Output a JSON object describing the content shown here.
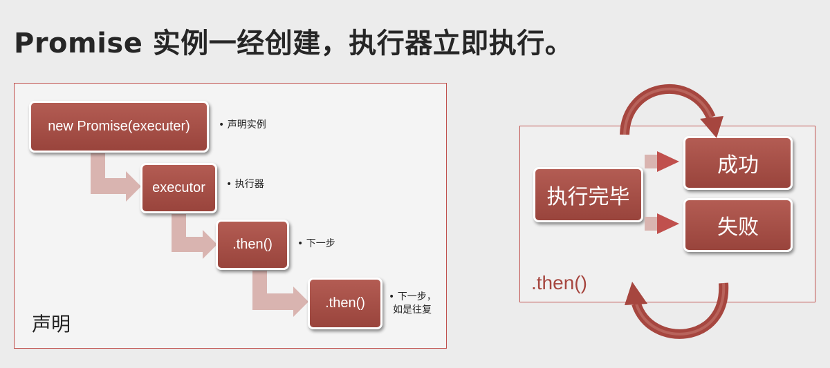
{
  "title": "Promise 实例一经创建，执行器立即执行。",
  "left_panel": {
    "label": "声明",
    "steps": [
      {
        "text": "new Promise(executer)",
        "note": "• 声明实例"
      },
      {
        "text": "executor",
        "note": "• 执行器"
      },
      {
        "text": ".then()",
        "note": "• 下一步"
      },
      {
        "text": ".then()",
        "note_lines": [
          "• 下一步，",
          "如是往复"
        ]
      }
    ]
  },
  "right_panel": {
    "center": "执行完毕",
    "success": "成功",
    "fail": "失败",
    "then_label": ".then()"
  },
  "colors": {
    "box": "#a94f47",
    "border": "#c0504d",
    "connector": "#d9b4b0",
    "arrow_tip": "#c0504d",
    "loop_arrow": "#a6463f"
  }
}
